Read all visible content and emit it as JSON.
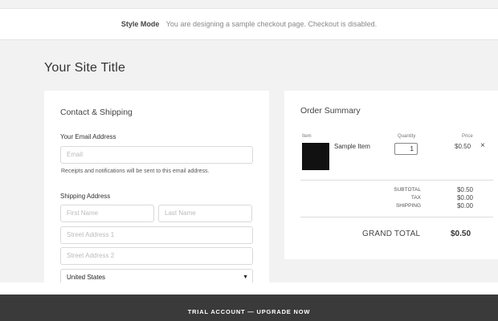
{
  "stylebar": {
    "mode_label": "Style Mode",
    "message": "You are designing a sample checkout page. Checkout is disabled."
  },
  "site_title": "Your Site Title",
  "contact": {
    "heading": "Contact & Shipping",
    "email_label": "Your Email Address",
    "email_placeholder": "Email",
    "email_hint": "Receipts and notifications will be sent to this email address.",
    "shipping_label": "Shipping Address",
    "first_name_placeholder": "First Name",
    "last_name_placeholder": "Last Name",
    "street1_placeholder": "Street Address 1",
    "street2_placeholder": "Street Address 2",
    "country": "United States"
  },
  "order": {
    "heading": "Order Summary",
    "col_item": "Item",
    "col_quantity": "Quantity",
    "col_price": "Price",
    "item_name": "Sample Item",
    "item_quantity": "1",
    "item_price": "$0.50",
    "remove_symbol": "×",
    "subtotal_label": "SUBTOTAL",
    "subtotal_value": "$0.50",
    "tax_label": "TAX",
    "tax_value": "$0.00",
    "shipping_label": "SHIPPING",
    "shipping_value": "$0.00",
    "grand_total_label": "GRAND TOTAL",
    "grand_total_value": "$0.50"
  },
  "footer": {
    "text": "TRIAL ACCOUNT — UPGRADE NOW"
  }
}
